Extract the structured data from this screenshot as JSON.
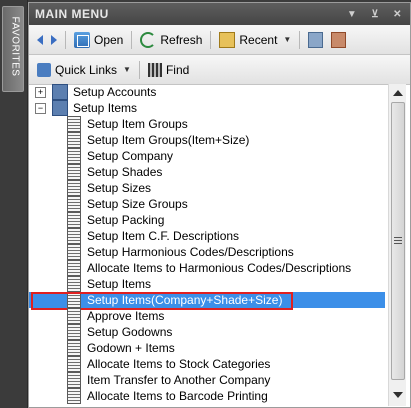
{
  "window": {
    "title": "MAIN MENU",
    "controls": [
      "▼",
      "⊻",
      "✕"
    ]
  },
  "favorites_tab": "FAVORITES",
  "toolbar": {
    "open_label": "Open",
    "refresh_label": "Refresh",
    "recent_label": "Recent"
  },
  "toolbar2": {
    "quick_links_label": "Quick Links",
    "find_label": "Find"
  },
  "tree": {
    "items": [
      {
        "label": "Setup Accounts",
        "level": 0,
        "expander": "+"
      },
      {
        "label": "Setup Items",
        "level": 0,
        "expander": "−"
      },
      {
        "label": "Setup Item Groups",
        "level": 1
      },
      {
        "label": "Setup Item Groups(Item+Size)",
        "level": 1
      },
      {
        "label": "Setup Company",
        "level": 1
      },
      {
        "label": "Setup Shades",
        "level": 1
      },
      {
        "label": "Setup Sizes",
        "level": 1
      },
      {
        "label": "Setup Size Groups",
        "level": 1
      },
      {
        "label": "Setup Packing",
        "level": 1
      },
      {
        "label": "Setup Item C.F. Descriptions",
        "level": 1
      },
      {
        "label": "Setup Harmonious Codes/Descriptions",
        "level": 1
      },
      {
        "label": "Allocate Items to Harmonious Codes/Descriptions",
        "level": 1
      },
      {
        "label": "Setup Items",
        "level": 1
      },
      {
        "label": "Setup Items(Company+Shade+Size)",
        "level": 1,
        "selected": true
      },
      {
        "label": "Approve Items",
        "level": 1
      },
      {
        "label": "Setup Godowns",
        "level": 1
      },
      {
        "label": "Godown + Items",
        "level": 1
      },
      {
        "label": "Allocate Items to Stock Categories",
        "level": 1
      },
      {
        "label": "Item Transfer to Another Company",
        "level": 1
      },
      {
        "label": "Allocate Items to Barcode Printing",
        "level": 1
      }
    ]
  },
  "colors": {
    "selection": "#3c8fe8",
    "highlight_outline": "#e02020",
    "titlebar": "#454545"
  }
}
